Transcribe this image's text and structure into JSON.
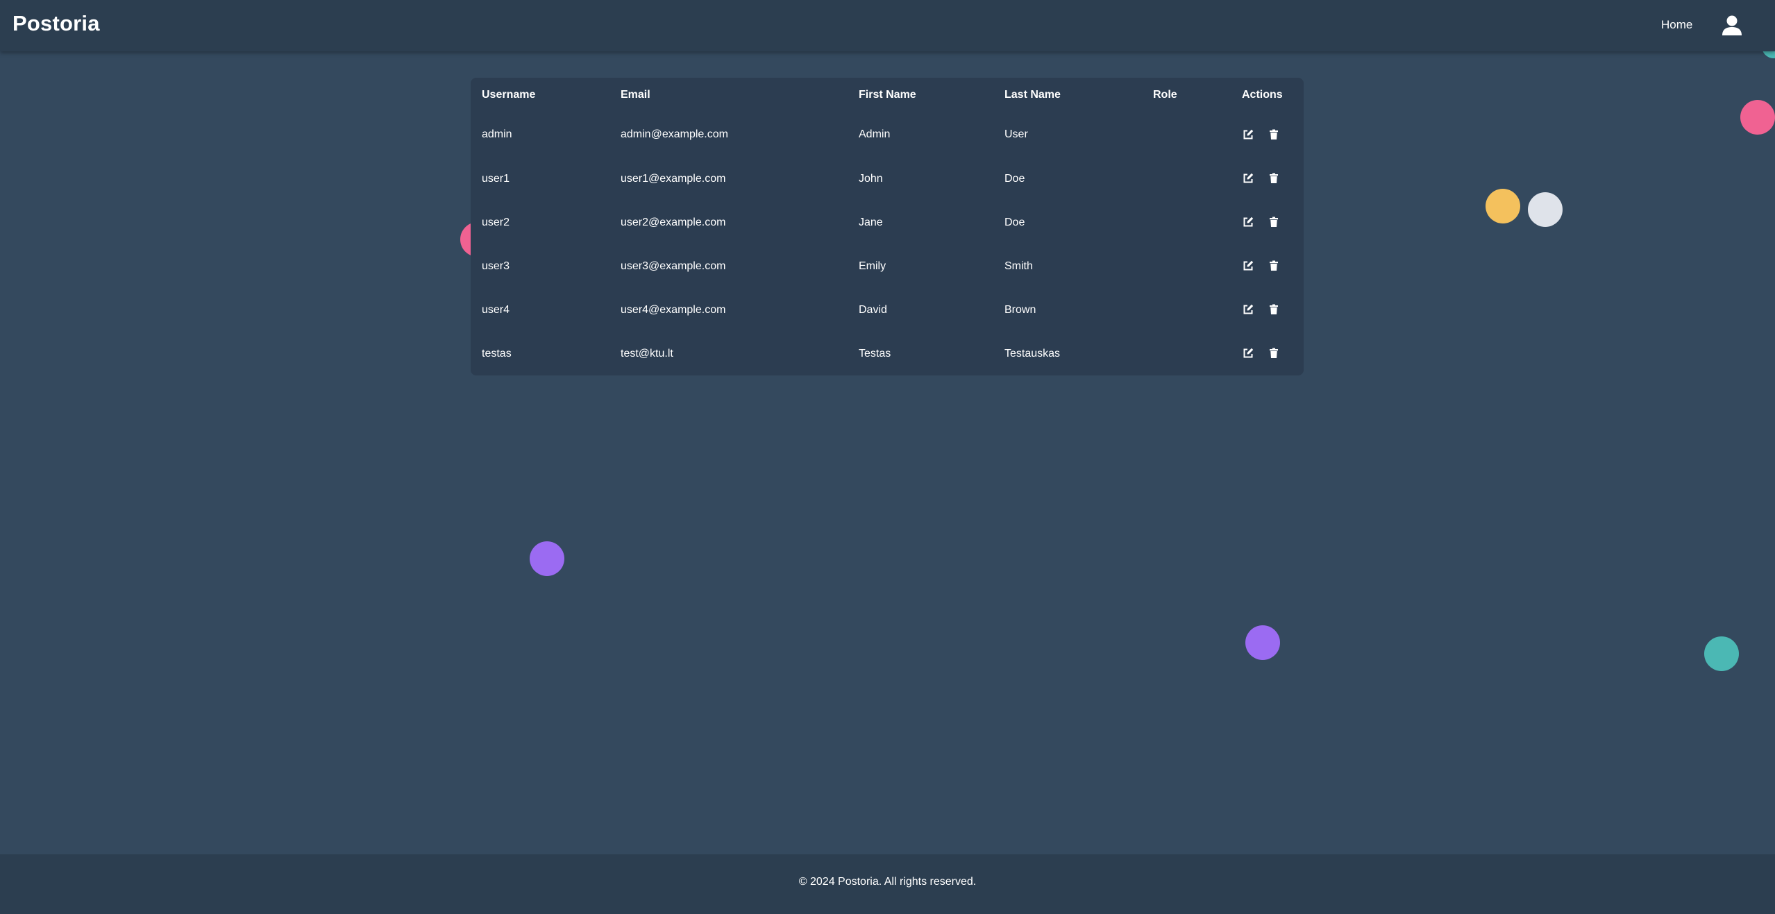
{
  "app": {
    "brand": "Postoria",
    "nav_home": "Home"
  },
  "table": {
    "headers": [
      "Username",
      "Email",
      "First Name",
      "Last Name",
      "Role",
      "Actions"
    ],
    "rows": [
      {
        "username": "admin",
        "email": "admin@example.com",
        "first_name": "Admin",
        "last_name": "User",
        "role": ""
      },
      {
        "username": "user1",
        "email": "user1@example.com",
        "first_name": "John",
        "last_name": "Doe",
        "role": ""
      },
      {
        "username": "user2",
        "email": "user2@example.com",
        "first_name": "Jane",
        "last_name": "Doe",
        "role": ""
      },
      {
        "username": "user3",
        "email": "user3@example.com",
        "first_name": "Emily",
        "last_name": "Smith",
        "role": ""
      },
      {
        "username": "user4",
        "email": "user4@example.com",
        "first_name": "David",
        "last_name": "Brown",
        "role": ""
      },
      {
        "username": "testas",
        "email": "test@ktu.lt",
        "first_name": "Testas",
        "last_name": "Testauskas",
        "role": ""
      }
    ],
    "row_actions": [
      "edit-icon",
      "trash-icon"
    ]
  },
  "footer": {
    "text": "© 2024 Postoria. All rights reserved."
  },
  "theme": {
    "background": "#34495e",
    "bar": "#2c3e50",
    "card": "#2c3d51",
    "bubble_colors": [
      "#f06292",
      "#f4c15d",
      "#dfe3ea",
      "#9b6bf2",
      "#4bb8b4"
    ]
  }
}
